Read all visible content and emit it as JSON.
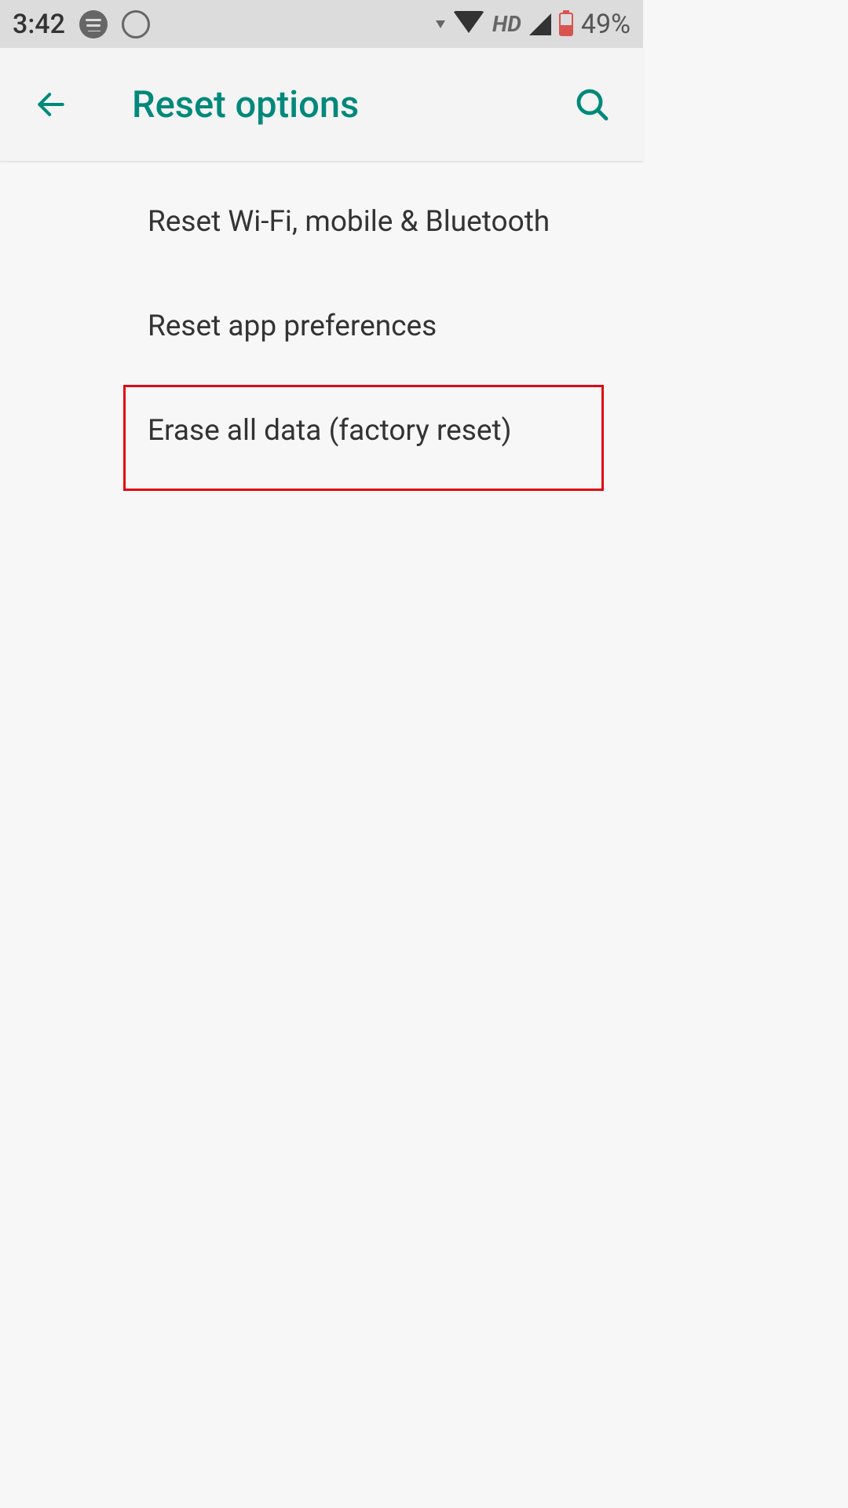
{
  "status_bar": {
    "time": "3:42",
    "hd_label": "HD",
    "battery_pct": "49%"
  },
  "app_bar": {
    "title": "Reset options"
  },
  "list": {
    "items": [
      {
        "label": "Reset Wi-Fi, mobile & Bluetooth"
      },
      {
        "label": "Reset app preferences"
      },
      {
        "label": "Erase all data (factory reset)"
      }
    ]
  },
  "colors": {
    "accent": "#00897b",
    "highlight": "#e30613"
  }
}
